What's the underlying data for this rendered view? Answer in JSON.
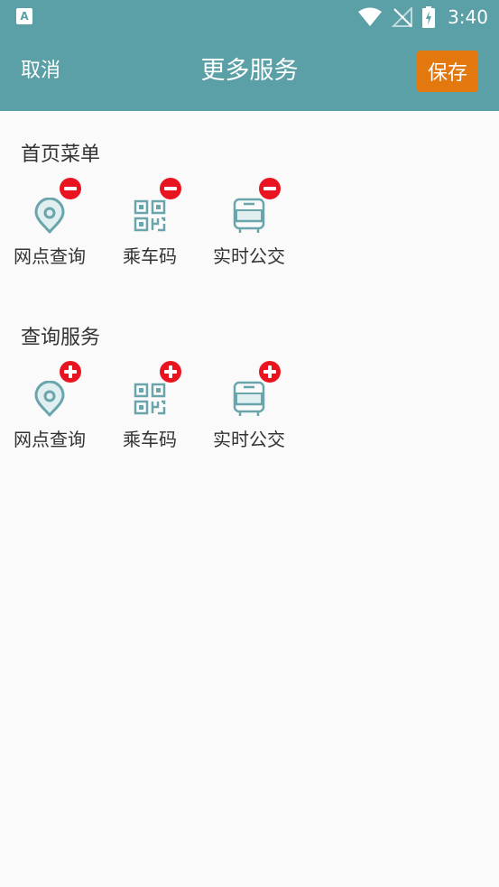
{
  "status_bar": {
    "time": "3:40"
  },
  "header": {
    "cancel_label": "取消",
    "title": "更多服务",
    "save_label": "保存"
  },
  "sections": [
    {
      "title": "首页菜单",
      "action": "remove",
      "items": [
        {
          "label": "网点查询",
          "icon": "location-pin-icon"
        },
        {
          "label": "乘车码",
          "icon": "qr-code-icon"
        },
        {
          "label": "实时公交",
          "icon": "bus-icon"
        }
      ]
    },
    {
      "title": "查询服务",
      "action": "add",
      "items": [
        {
          "label": "网点查询",
          "icon": "location-pin-icon"
        },
        {
          "label": "乘车码",
          "icon": "qr-code-icon"
        },
        {
          "label": "实时公交",
          "icon": "bus-icon"
        }
      ]
    }
  ],
  "colors": {
    "primary": "#5ba0a6",
    "save_button": "#e3780f",
    "badge": "#e8141f",
    "icon": "#6aa5ab",
    "background": "#fafafa"
  }
}
